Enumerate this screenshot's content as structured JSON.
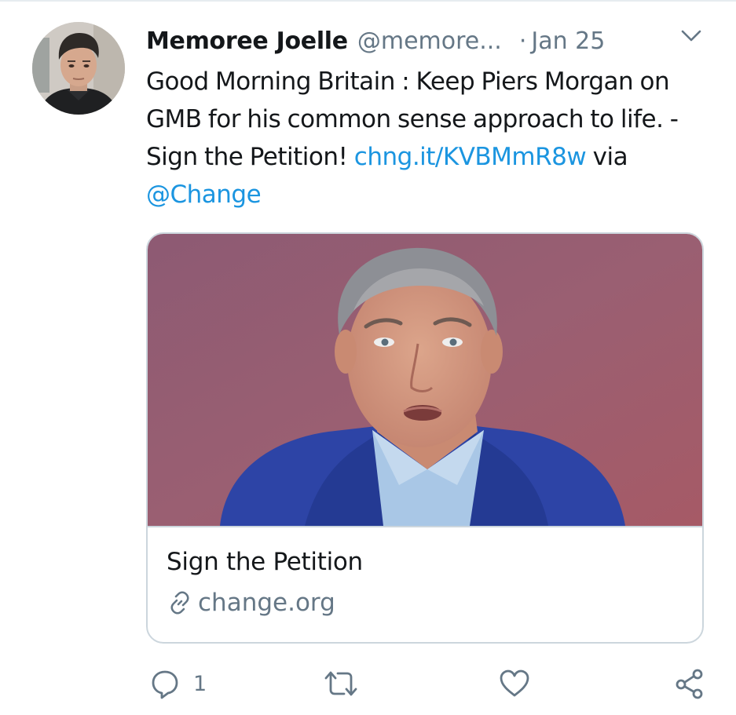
{
  "tweet": {
    "author": {
      "display_name": "Memoree Joelle",
      "handle": "@memore...",
      "avatar_icon": "user-avatar-photo"
    },
    "separator": "·",
    "date": "Jan 25",
    "text_plain": "Good Morning Britain : Keep Piers Morgan on GMB for his common sense approach to life. - Sign the Petition! ",
    "link_text": "chng.it/KVBMmR8w",
    "via_text": " via ",
    "mention_text": "@Change",
    "menu_icon": "chevron-down-icon"
  },
  "card": {
    "image_icon": "man-portrait-photo",
    "title": "Sign the Petition",
    "domain": "change.org",
    "domain_icon": "link-icon"
  },
  "actions": {
    "reply_icon": "reply-icon",
    "reply_count": "1",
    "retweet_icon": "retweet-icon",
    "like_icon": "heart-icon",
    "share_icon": "share-icon"
  },
  "colors": {
    "link": "#1b95e0",
    "secondary_text": "#657786",
    "primary_text": "#14171a",
    "border": "#ccd6dd"
  }
}
